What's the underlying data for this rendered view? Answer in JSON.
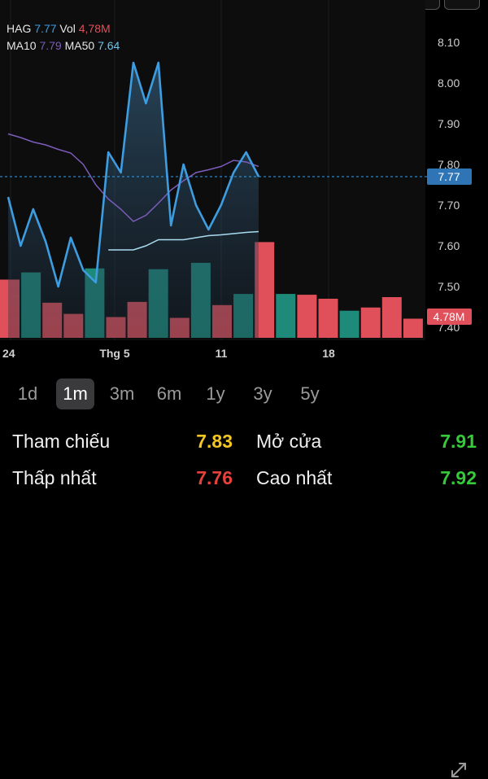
{
  "legend": {
    "ticker": "HAG",
    "price": "7.77",
    "vol_label": "Vol",
    "vol_value": "4,78M",
    "ma10_label": "MA10",
    "ma10_value": "7.79",
    "ma50_label": "MA50",
    "ma50_value": "7.64"
  },
  "colors": {
    "price_line": "#3d9de0",
    "ma10": "#7c5cb8",
    "ma50": "#a9dcf0",
    "vol_up": "#1e8a7a",
    "vol_down": "#e0505a",
    "ref": "#f3c623",
    "up": "#36c93a",
    "down": "#e8413c"
  },
  "chart_data": {
    "type": "line",
    "x_labels": [
      "24",
      "Thg 5",
      "11",
      "18"
    ],
    "y_ticks": [
      8.1,
      8.0,
      7.9,
      7.8,
      7.7,
      7.6,
      7.5,
      7.4
    ],
    "ylim": [
      7.4,
      8.15
    ],
    "price": [
      7.72,
      7.6,
      7.69,
      7.61,
      7.5,
      7.62,
      7.54,
      7.51,
      7.83,
      7.78,
      8.05,
      7.95,
      8.05,
      7.65,
      7.8,
      7.7,
      7.64,
      7.7,
      7.78,
      7.83,
      7.77
    ],
    "ma10": [
      7.875,
      7.866,
      7.855,
      7.848,
      7.837,
      7.828,
      7.8,
      7.75,
      7.715,
      7.69,
      7.66,
      7.675,
      7.705,
      7.737,
      7.76,
      7.78,
      7.787,
      7.795,
      7.81,
      7.806,
      7.795
    ],
    "ma50_start_index": 8,
    "ma50": [
      7.59,
      7.59,
      7.59,
      7.6,
      7.615,
      7.615,
      7.615,
      7.62,
      7.625,
      7.627,
      7.63,
      7.633,
      7.635
    ],
    "volume": [
      0.73,
      0.82,
      0.44,
      0.3,
      0.87,
      0.26,
      0.45,
      0.86,
      0.25,
      0.94,
      0.41,
      0.55,
      1.2,
      0.55,
      0.54,
      0.49,
      0.34,
      0.38,
      0.51,
      0.24
    ],
    "volume_up": [
      false,
      true,
      false,
      false,
      true,
      false,
      false,
      true,
      false,
      true,
      false,
      true,
      false,
      true,
      false,
      false,
      true,
      false,
      false,
      false
    ],
    "current_price_tag": "7.77",
    "current_volume_tag": "4.78M"
  },
  "timeframes": [
    "1d",
    "1m",
    "3m",
    "6m",
    "1y",
    "3y",
    "5y"
  ],
  "active_timeframe": "1m",
  "stats": {
    "ref_label": "Tham chiếu",
    "ref_value": "7.83",
    "open_label": "Mở cửa",
    "open_value": "7.91",
    "low_label": "Thấp nhất",
    "low_value": "7.76",
    "high_label": "Cao nhất",
    "high_value": "7.92"
  }
}
